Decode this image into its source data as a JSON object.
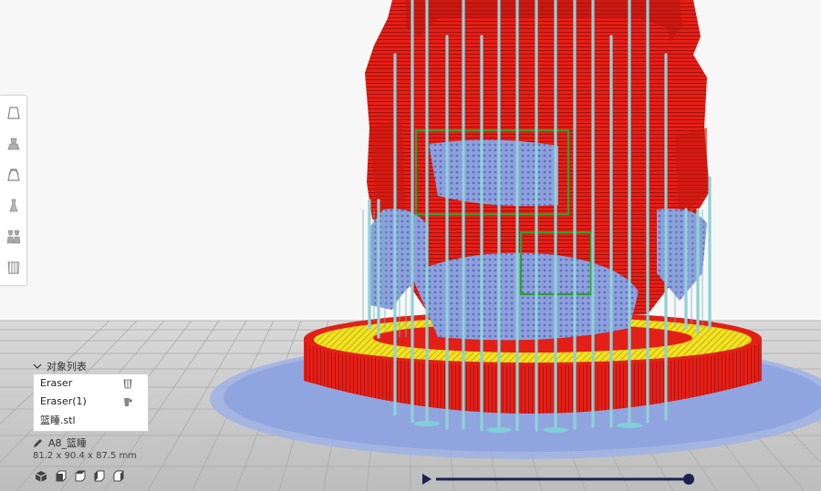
{
  "object_list": {
    "header": "对象列表",
    "items": [
      {
        "label": "Eraser",
        "icon": "support-blocker-icon"
      },
      {
        "label": "Eraser(1)",
        "icon": "support-blocker-icon"
      },
      {
        "label": "篮睡.stl",
        "icon": ""
      }
    ]
  },
  "selected": {
    "name": "A8_篮睡",
    "dimensions": "81.2 x 90.4 x 87.5 mm"
  },
  "colors": {
    "model_red": "#e8201a",
    "support_cyan": "#8fd3d8",
    "support_blue": "#7f93d6",
    "infill_yellow": "#f2e21a",
    "blocker_green": "#2fa12f",
    "slider_navy": "#1c2350"
  },
  "layer_slider": {
    "value_fraction": 1.0
  }
}
